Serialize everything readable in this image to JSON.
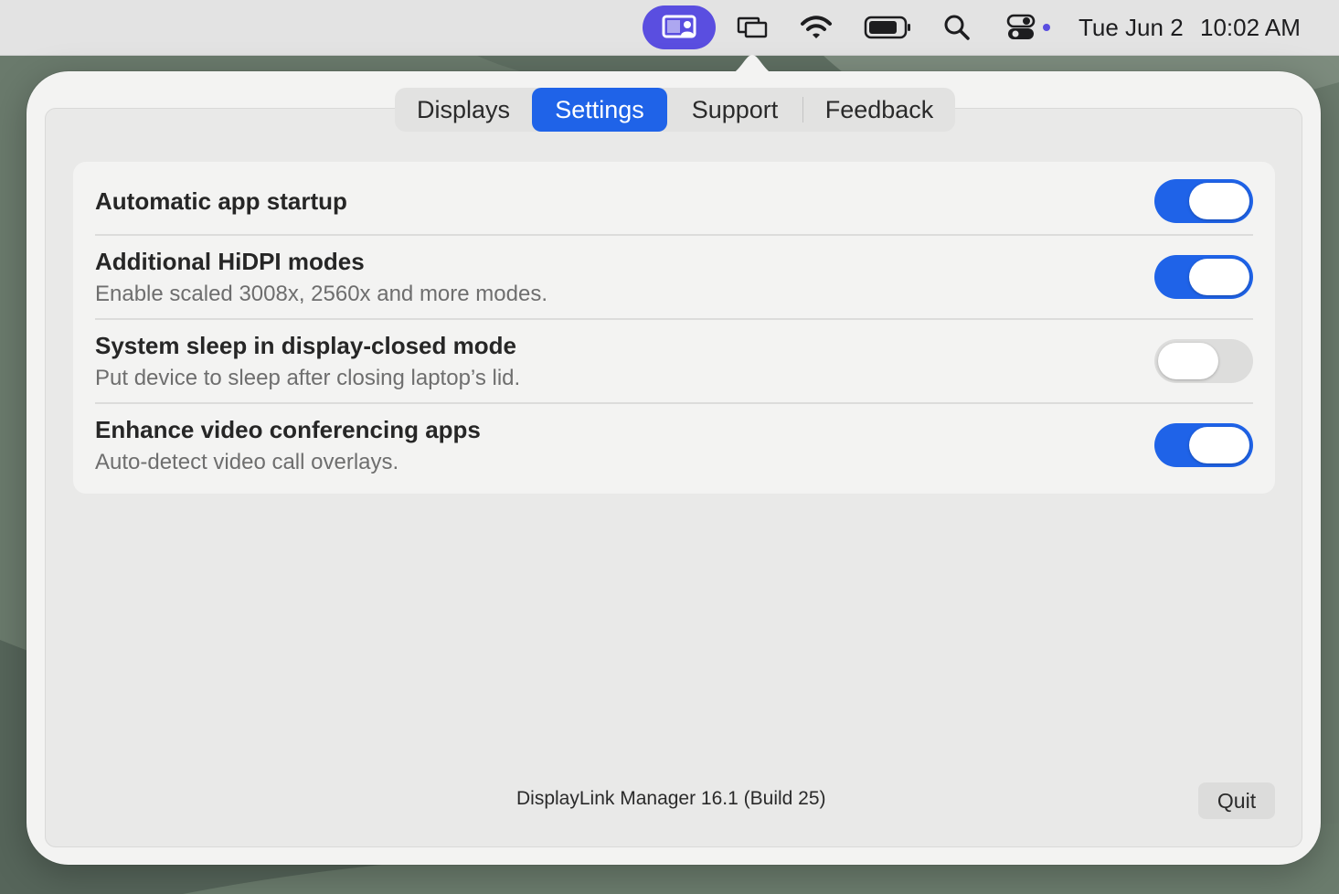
{
  "menubar": {
    "icons": [
      "displaylink-app-icon",
      "display-mirror-icon",
      "wifi-icon",
      "battery-icon",
      "spotlight-search-icon",
      "control-center-icon"
    ],
    "date": "Tue Jun 2",
    "time": "10:02 AM",
    "active_color": "#5a4ee0"
  },
  "tabs": [
    {
      "label": "Displays",
      "active": false
    },
    {
      "label": "Settings",
      "active": true
    },
    {
      "label": "Support",
      "active": false
    },
    {
      "label": "Feedback",
      "active": false
    }
  ],
  "settings": [
    {
      "title": "Automatic app startup",
      "subtitle": "",
      "enabled": true
    },
    {
      "title": "Additional HiDPI modes",
      "subtitle": "Enable scaled 3008x, 2560x and more modes.",
      "enabled": true
    },
    {
      "title": "System sleep in display-closed mode",
      "subtitle": "Put device to sleep after closing laptop’s lid.",
      "enabled": false
    },
    {
      "title": "Enhance video conferencing apps",
      "subtitle": "Auto-detect video call overlays.",
      "enabled": true
    }
  ],
  "footer": {
    "version": "DisplayLink Manager 16.1 (Build 25)",
    "quit_label": "Quit"
  },
  "colors": {
    "accent": "#1f63e8",
    "toggle_off": "#dddddc"
  }
}
